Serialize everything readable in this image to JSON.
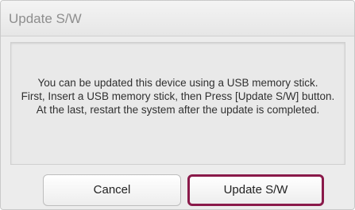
{
  "dialog": {
    "title": "Update S/W",
    "message_lines": [
      "You can be updated this device using a USB memory stick.",
      "First, Insert a USB memory stick, then Press [Update S/W] button.",
      "At the last, restart the system after the update is completed."
    ],
    "buttons": {
      "cancel_label": "Cancel",
      "update_label": "Update S/W"
    },
    "colors": {
      "focus_border": "#8a1a4a",
      "title_text": "#8e8e8e"
    }
  }
}
